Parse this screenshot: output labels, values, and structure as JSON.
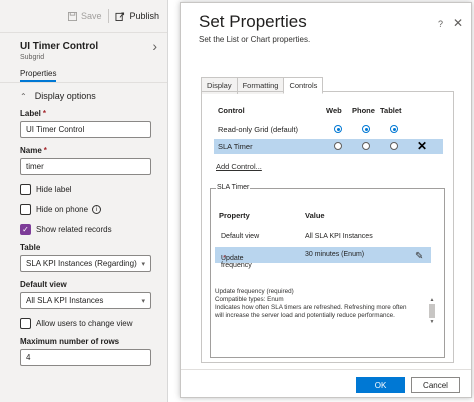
{
  "left_panel": {
    "toolbar": {
      "save_label": "Save",
      "publish_label": "Publish"
    },
    "component_title": "UI Timer Control",
    "component_subtitle": "Subgrid",
    "tab_properties": "Properties",
    "section_display_options": "Display options",
    "label_field": {
      "label": "Label",
      "value": "UI Timer Control"
    },
    "name_field": {
      "label": "Name",
      "value": "timer"
    },
    "hide_label": {
      "label": "Hide label",
      "checked": false
    },
    "hide_on_phone": {
      "label": "Hide on phone",
      "checked": false
    },
    "show_related": {
      "label": "Show related records",
      "checked": true
    },
    "table_field": {
      "label": "Table",
      "value": "SLA KPI Instances (Regarding)"
    },
    "default_view_field": {
      "label": "Default view",
      "value": "All SLA KPI Instances"
    },
    "allow_change_view": {
      "label": "Allow users to change view",
      "checked": false
    },
    "max_rows_field": {
      "label": "Maximum number of rows",
      "value": "4"
    }
  },
  "dialog": {
    "title": "Set Properties",
    "subtitle": "Set the List or Chart properties.",
    "tabs": [
      {
        "label": "Display",
        "active": false
      },
      {
        "label": "Formatting",
        "active": false
      },
      {
        "label": "Controls",
        "active": true
      }
    ],
    "controls_table": {
      "headers": {
        "control": "Control",
        "web": "Web",
        "phone": "Phone",
        "tablet": "Tablet"
      },
      "rows": [
        {
          "name": "Read-only Grid (default)",
          "web": true,
          "phone": true,
          "tablet": true,
          "selected": false
        },
        {
          "name": "SLA Timer",
          "web": false,
          "phone": false,
          "tablet": false,
          "selected": true
        }
      ],
      "add_control": "Add Control..."
    },
    "sla_timer_group": {
      "legend": "SLA Timer",
      "headers": {
        "property": "Property",
        "value": "Value"
      },
      "rows": [
        {
          "property": "Default view",
          "value": "All SLA KPI Instances",
          "required": false,
          "selected": false
        },
        {
          "property": "Update frequency",
          "value": "30 minutes (Enum)",
          "required": true,
          "selected": true
        }
      ],
      "description": [
        "Update frequency (required)",
        "Compatible types: Enum",
        "Indicates how often SLA timers are refreshed. Refreshing more often will increase the server load and potentially reduce performance."
      ]
    },
    "buttons": {
      "ok": "OK",
      "cancel": "Cancel"
    }
  },
  "colors": {
    "accent": "#0078d4",
    "selection": "#b9d5ee",
    "checkbox_on": "#7d3c98",
    "required": "#a4262c"
  }
}
